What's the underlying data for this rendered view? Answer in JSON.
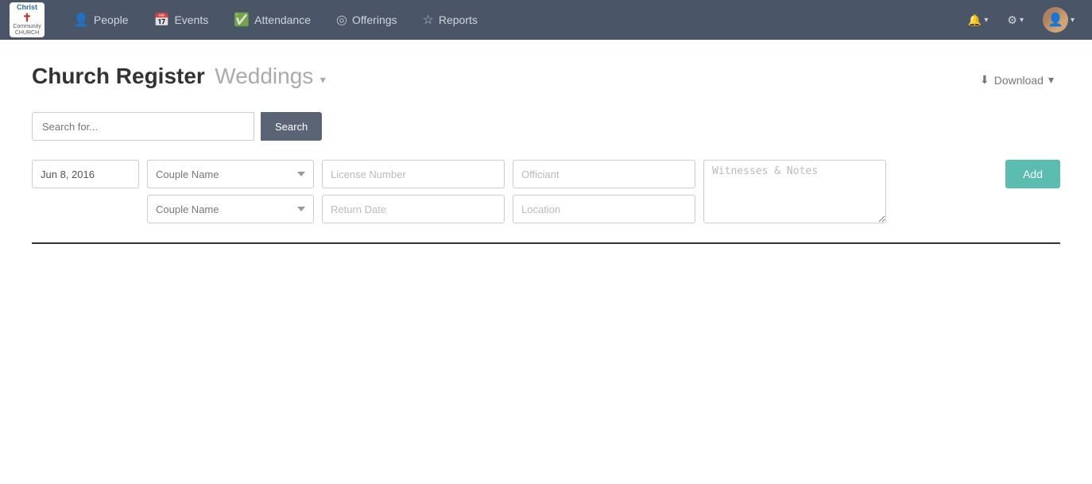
{
  "app": {
    "logo": {
      "top": "Christ",
      "cross": "✝",
      "bottom": "Community CHURCH"
    }
  },
  "navbar": {
    "items": [
      {
        "id": "people",
        "label": "People",
        "icon": "👤"
      },
      {
        "id": "events",
        "label": "Events",
        "icon": "📅"
      },
      {
        "id": "attendance",
        "label": "Attendance",
        "icon": "✅"
      },
      {
        "id": "offerings",
        "label": "Offerings",
        "icon": "◎"
      },
      {
        "id": "reports",
        "label": "Reports",
        "icon": "☆"
      }
    ],
    "right": {
      "notifications_icon": "🔔",
      "settings_icon": "⚙",
      "profile_caret": "▾"
    }
  },
  "page": {
    "title_main": "Church Register",
    "title_sub": "Weddings",
    "title_caret": "▾",
    "download_label": "Download",
    "download_caret": "▾"
  },
  "search": {
    "placeholder": "Search for...",
    "button_label": "Search"
  },
  "form": {
    "date_value": "Jun 8, 2016",
    "couple_name_1_placeholder": "Couple Name",
    "couple_name_2_placeholder": "Couple Name",
    "license_number_placeholder": "License Number",
    "return_date_placeholder": "Return Date",
    "officiant_placeholder": "Officiant",
    "location_placeholder": "Location",
    "witnesses_notes_placeholder": "Witnesses & Notes",
    "add_button_label": "Add"
  }
}
